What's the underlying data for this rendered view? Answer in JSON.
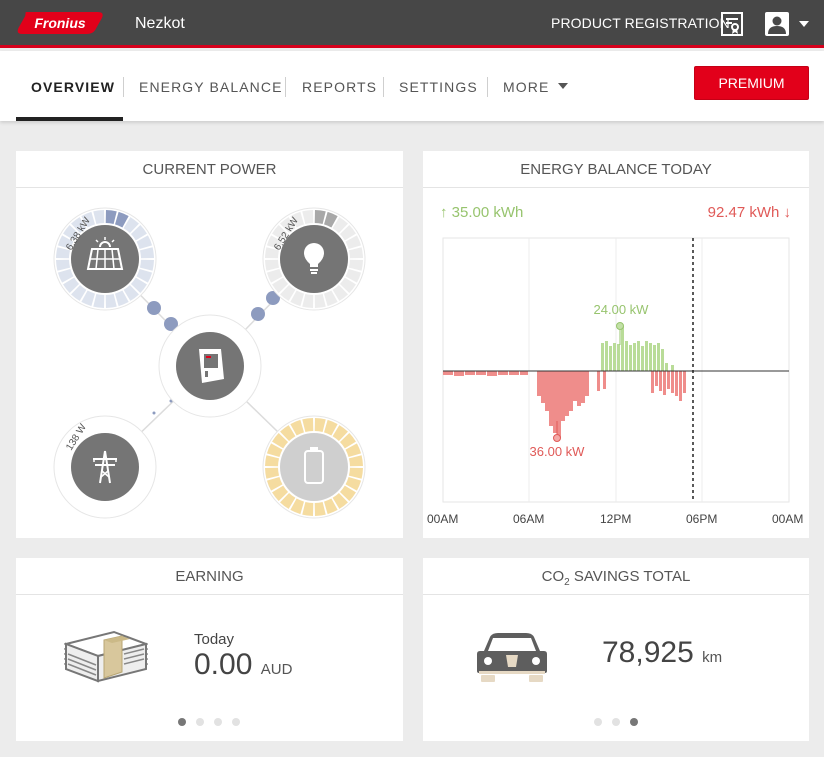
{
  "header": {
    "brand": "Fronius",
    "site_name": "Nezkot",
    "product_registration": "PRODUCT REGISTRATION"
  },
  "nav": {
    "items": [
      {
        "label": "OVERVIEW",
        "active": true
      },
      {
        "label": "ENERGY BALANCE",
        "active": false
      },
      {
        "label": "REPORTS",
        "active": false
      },
      {
        "label": "SETTINGS",
        "active": false
      },
      {
        "label": "MORE",
        "active": false
      }
    ],
    "premium_label": "PREMIUM"
  },
  "current_power": {
    "title": "CURRENT POWER",
    "pv": {
      "value": "6.38 kW",
      "icon": "solar-panel-icon"
    },
    "load": {
      "value": "6.52 kW",
      "icon": "lightbulb-icon"
    },
    "grid": {
      "value": "138 W",
      "icon": "power-pylon-icon"
    },
    "inverter": {
      "icon": "inverter-icon"
    },
    "battery": {
      "icon": "battery-icon"
    }
  },
  "energy_balance": {
    "title": "ENERGY BALANCE TODAY",
    "production": "↑ 35.00 kWh",
    "consumption": "92.47 kWh ↓",
    "peak_label": "24.00 kW",
    "min_label": "36.00 kW",
    "x_labels": [
      "00AM",
      "06AM",
      "12PM",
      "06PM",
      "00AM"
    ]
  },
  "earning": {
    "title": "EARNING",
    "label": "Today",
    "value": "0.00",
    "unit": "AUD",
    "active_dot": 0
  },
  "co2": {
    "title_main": "CO",
    "title_sub": "2",
    "title_rest": " SAVINGS TOTAL",
    "value": "78,925",
    "unit": "km",
    "active_dot": 2
  },
  "colors": {
    "brand_red": "#e2001a",
    "production_green": "#97c46e",
    "consumption_red": "#e05a58",
    "pv_blue": "#8d9bbf",
    "battery_yellow": "#f5dca0"
  }
}
